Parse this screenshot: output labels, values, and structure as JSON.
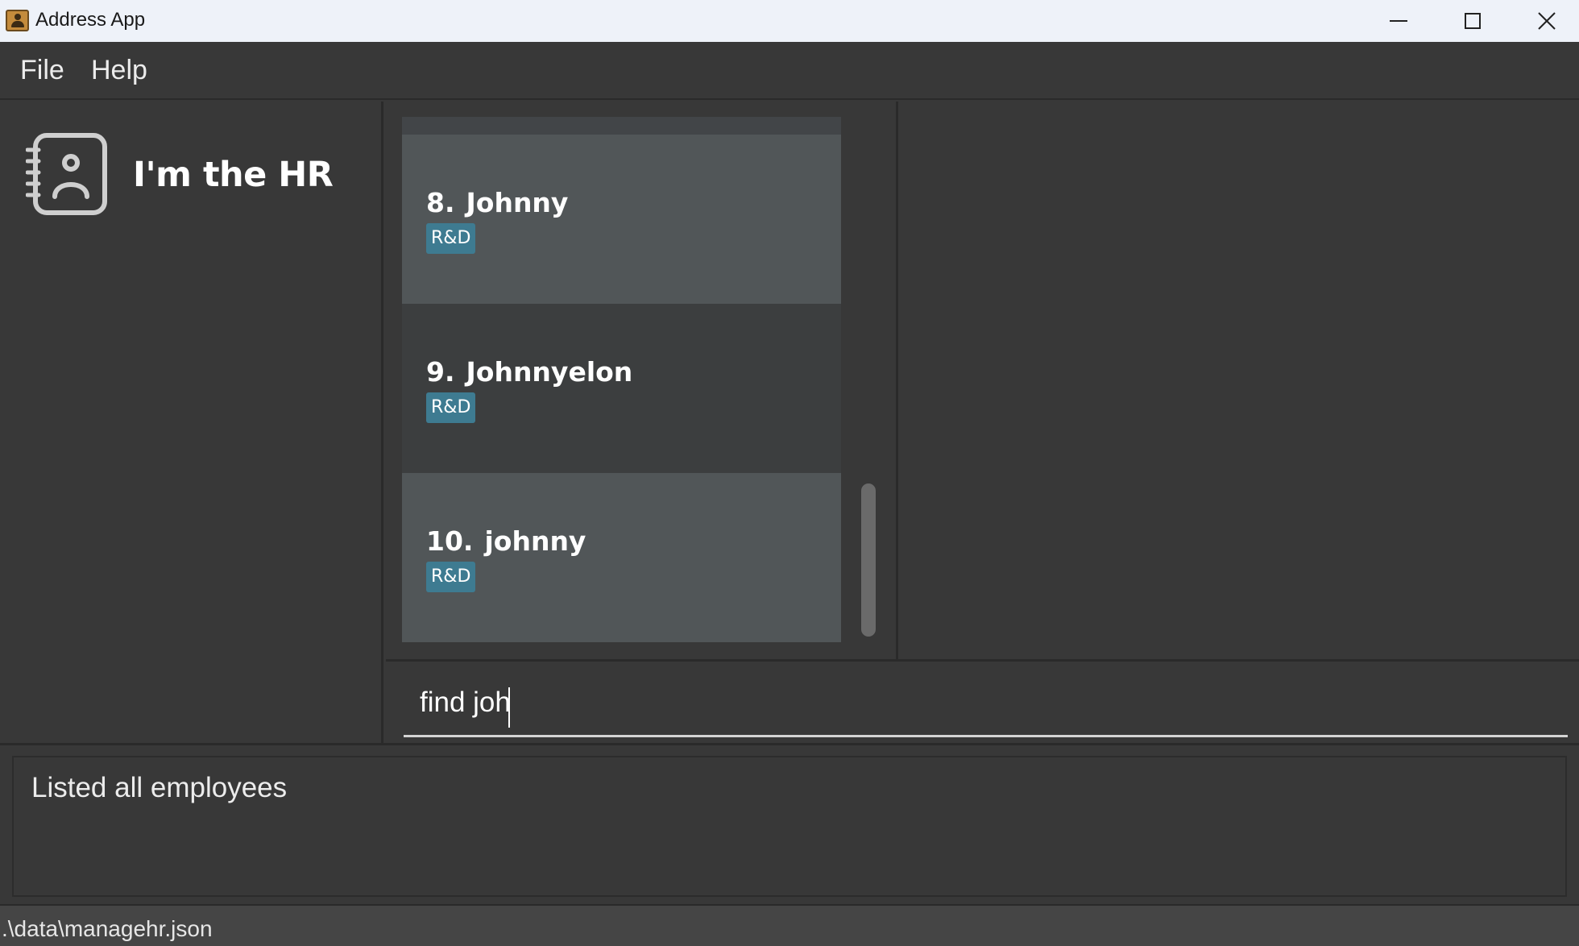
{
  "window": {
    "title": "Address App",
    "controls": [
      "minimize-icon",
      "maximize-icon",
      "close-icon"
    ]
  },
  "menu": {
    "file": "File",
    "help": "Help"
  },
  "sidebar": {
    "title": "I'm the HR",
    "logo_icon": "contact-book-icon"
  },
  "employees": [
    {
      "index": "8.",
      "name": "Johnny",
      "tag": "R&D"
    },
    {
      "index": "9.",
      "name": "Johnnyelon",
      "tag": "R&D"
    },
    {
      "index": "10.",
      "name": "johnny",
      "tag": "R&D"
    }
  ],
  "command": {
    "value": "find joh"
  },
  "result": {
    "message": "Listed all employees"
  },
  "status": {
    "file_path": ".\\data\\managehr.json"
  },
  "colors": {
    "background": "#383838",
    "card_selected": "#515658",
    "tag": "#3e7b91",
    "titlebar": "#eef2f9"
  }
}
